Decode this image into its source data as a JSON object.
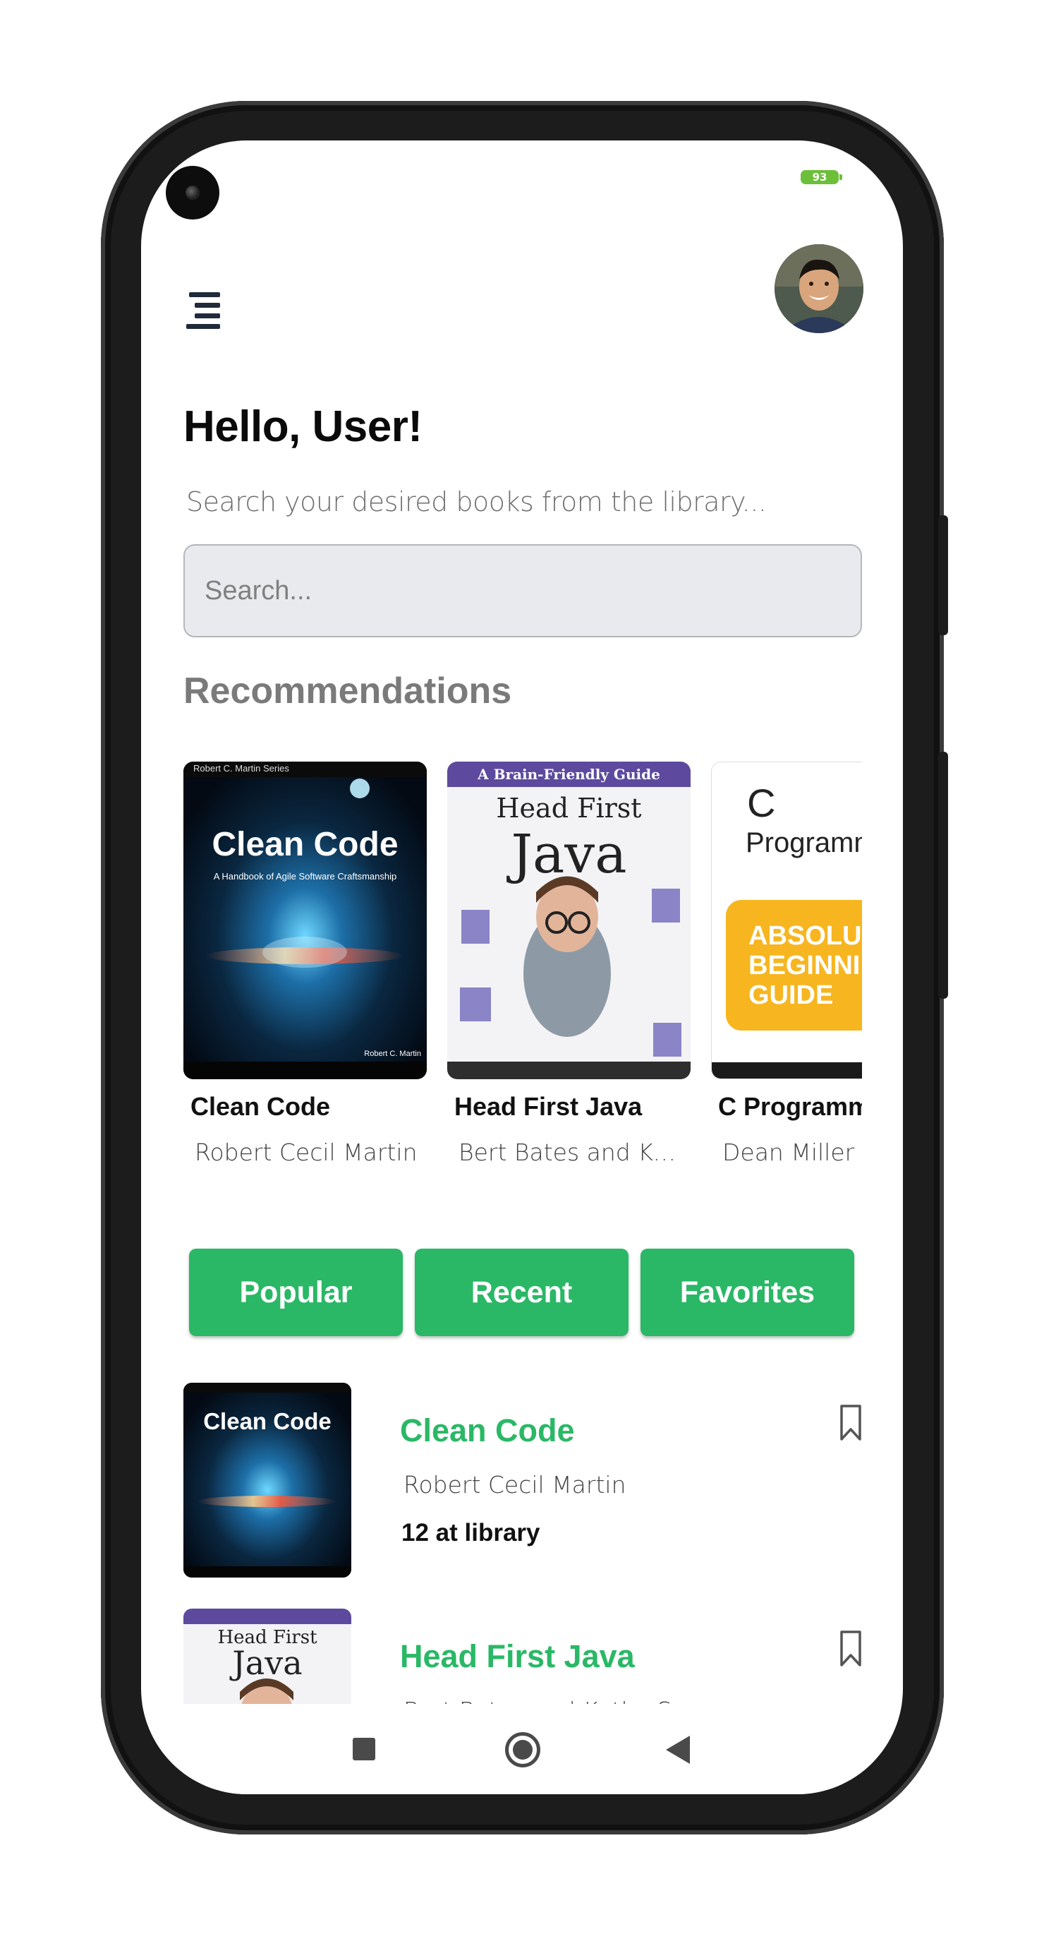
{
  "status_bar": {
    "battery": "93"
  },
  "header": {
    "greeting": "Hello, User!",
    "subtitle": "Search your desired books from the library...",
    "search_placeholder": "Search..."
  },
  "recommendations": {
    "title": "Recommendations",
    "items": [
      {
        "title": "Clean Code",
        "author": "Robert Cecil Martin",
        "cover_title": "Clean Code",
        "cover_subtitle": "A Handbook of Agile Software Craftsmanship",
        "cover_series": "Robert C. Martin Series",
        "cover_author": "Robert C. Martin"
      },
      {
        "title": "Head First Java",
        "author": "Bert Bates and Kat...",
        "cover_banner": "A Brain-Friendly Guide",
        "cover_title_1": "Head First",
        "cover_title_2": "Java"
      },
      {
        "title": "C Programm",
        "author": "Dean Miller ar",
        "cover_title_1": "C",
        "cover_title_2": "Programm",
        "cover_badge": "ABSOLU BEGINNI GUIDE"
      }
    ]
  },
  "tabs": [
    "Popular",
    "Recent",
    "Favorites"
  ],
  "list": [
    {
      "title": "Clean Code",
      "author": "Robert Cecil Martin",
      "count": "12 at library"
    },
    {
      "title": "Head First Java",
      "author": "Bert Bates and Kathy S...",
      "count": ""
    }
  ],
  "colors": {
    "accent": "#2ab866",
    "search_bg": "#e8eaed"
  },
  "icons": [
    "menu-icon",
    "bookmark-icon",
    "square-nav-icon",
    "home-nav-icon",
    "back-nav-icon"
  ]
}
